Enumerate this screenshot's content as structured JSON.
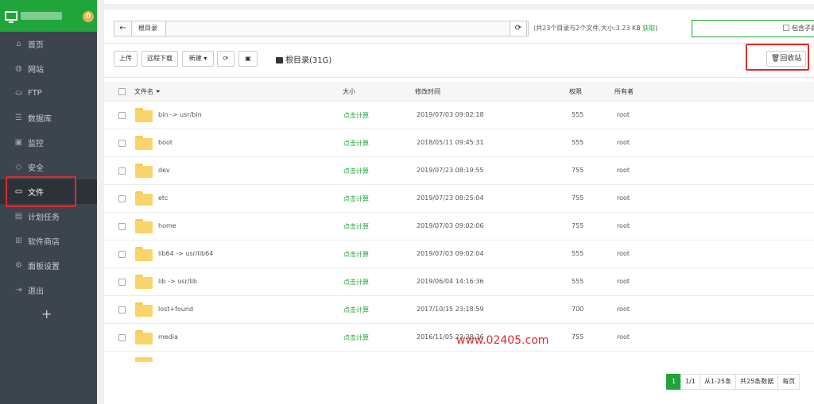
{
  "sidebar": {
    "badge": "0",
    "items": [
      {
        "label": "首页",
        "icon": "home-icon",
        "glyph": "⌂"
      },
      {
        "label": "网站",
        "icon": "globe-icon",
        "glyph": "◍"
      },
      {
        "label": "FTP",
        "icon": "ftp-icon",
        "glyph": "⛀"
      },
      {
        "label": "数据库",
        "icon": "database-icon",
        "glyph": "☰"
      },
      {
        "label": "监控",
        "icon": "monitor-chart-icon",
        "glyph": "▣"
      },
      {
        "label": "安全",
        "icon": "shield-icon",
        "glyph": "◇"
      },
      {
        "label": "文件",
        "icon": "folder-icon",
        "glyph": "▭",
        "active": true
      },
      {
        "label": "计划任务",
        "icon": "calendar-icon",
        "glyph": "▤"
      },
      {
        "label": "软件商店",
        "icon": "apps-icon",
        "glyph": "⊞"
      },
      {
        "label": "面板设置",
        "icon": "gear-icon",
        "glyph": "⚙"
      },
      {
        "label": "退出",
        "icon": "logout-icon",
        "glyph": "⇥"
      }
    ],
    "add_label": "+"
  },
  "path": {
    "crumb": "根目录",
    "summary_text": "(共23个目录与2个文件,大小:3.23 KB",
    "summary_link": "获取",
    "summary_close": ")"
  },
  "search": {
    "include_sub_label": "包含子目"
  },
  "toolbar": {
    "upload": "上传",
    "remote_download": "远程下载",
    "new": "新建 ▾",
    "disk_label": "根目录(31G)",
    "recycle_bin": "回收站"
  },
  "table": {
    "headers": {
      "name": "文件名 ⏷",
      "size": "大小",
      "modified": "修改时间",
      "permission": "权限",
      "owner": "所有者"
    },
    "rows": [
      {
        "name": "bin -> usr/bin",
        "size": "点击计算",
        "modified": "2019/07/03 09:02:18",
        "perm": "555",
        "owner": "root"
      },
      {
        "name": "boot",
        "size": "点击计算",
        "modified": "2018/05/11 09:45:31",
        "perm": "555",
        "owner": "root"
      },
      {
        "name": "dev",
        "size": "点击计算",
        "modified": "2019/07/23 08:19:55",
        "perm": "755",
        "owner": "root"
      },
      {
        "name": "etc",
        "size": "点击计算",
        "modified": "2019/07/23 08:25:04",
        "perm": "755",
        "owner": "root"
      },
      {
        "name": "home",
        "size": "点击计算",
        "modified": "2019/07/03 09:02:06",
        "perm": "755",
        "owner": "root"
      },
      {
        "name": "lib64 -> usr/lib64",
        "size": "点击计算",
        "modified": "2019/07/03 09:02:04",
        "perm": "555",
        "owner": "root"
      },
      {
        "name": "lib -> usr/lib",
        "size": "点击计算",
        "modified": "2019/06/04 14:16:36",
        "perm": "555",
        "owner": "root"
      },
      {
        "name": "lost+found",
        "size": "点击计算",
        "modified": "2017/10/15 23:18:59",
        "perm": "700",
        "owner": "root"
      },
      {
        "name": "media",
        "size": "点击计算",
        "modified": "2016/11/05 23:38:36",
        "perm": "755",
        "owner": "root"
      }
    ]
  },
  "pager": {
    "current": "1",
    "pages": "1/1",
    "range": "从1-25条",
    "total": "共25条数据",
    "per_page": "每页"
  },
  "watermark": "www.02405.com"
}
